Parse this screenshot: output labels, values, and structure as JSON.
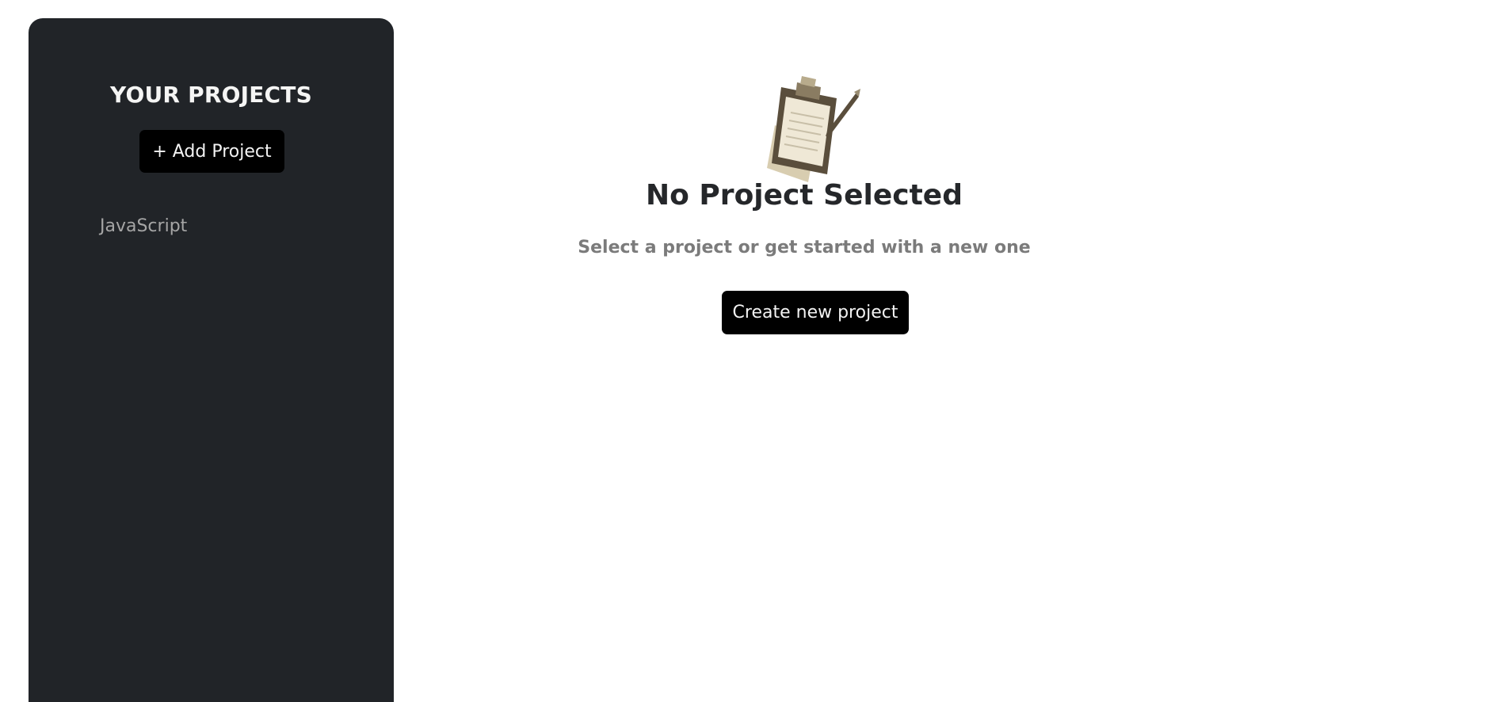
{
  "sidebar": {
    "title": "YOUR PROJECTS",
    "add_button_label": "+ Add Project",
    "projects": [
      {
        "label": "JavaScript"
      }
    ]
  },
  "main": {
    "icon": "clipboard-with-pen-icon",
    "title": "No Project Selected",
    "subtitle": "Select a project or get started with a new one",
    "create_button_label": "Create new project"
  },
  "colors": {
    "sidebar_bg": "#212428",
    "button_bg": "#000000",
    "heading_text": "#25272a",
    "muted_text": "#7b7b7b",
    "project_text": "#a5a5a5"
  }
}
